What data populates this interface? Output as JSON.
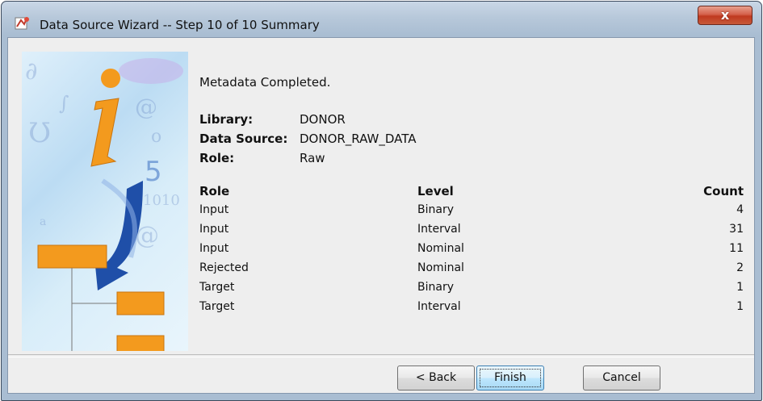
{
  "window": {
    "title": "Data Source Wizard  -- Step 10 of 10  Summary",
    "close_label": "x"
  },
  "summary": {
    "heading": "Metadata Completed.",
    "info": [
      {
        "label": "Library:",
        "value": "DONOR"
      },
      {
        "label": "Data Source:",
        "value": "DONOR_RAW_DATA"
      },
      {
        "label": "Role:",
        "value": "Raw"
      }
    ]
  },
  "table": {
    "headers": {
      "role": "Role",
      "level": "Level",
      "count": "Count"
    },
    "rows": [
      {
        "role": "Input",
        "level": "Binary",
        "count": "4"
      },
      {
        "role": "Input",
        "level": "Interval",
        "count": "31"
      },
      {
        "role": "Input",
        "level": "Nominal",
        "count": "11"
      },
      {
        "role": "Rejected",
        "level": "Nominal",
        "count": "2"
      },
      {
        "role": "Target",
        "level": "Binary",
        "count": "1"
      },
      {
        "role": "Target",
        "level": "Interval",
        "count": "1"
      }
    ]
  },
  "buttons": {
    "back": "< Back",
    "finish": "Finish",
    "cancel": "Cancel"
  },
  "colors": {
    "accent_orange": "#f39a1e",
    "arrow_blue": "#1f4fa8",
    "titlebar": "#b7c8da",
    "close_red": "#c0391f"
  }
}
